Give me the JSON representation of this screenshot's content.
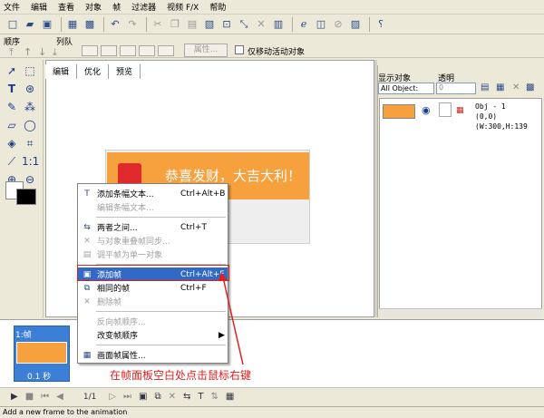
{
  "menu": [
    "文件",
    "编辑",
    "查看",
    "对象",
    "帧",
    "过滤器",
    "视频 F/X",
    "帮助"
  ],
  "order_bar": {
    "order_label": "顺序",
    "arrange_label": "列队",
    "properties_button": "属性...",
    "move_active_label": "仅移动活动对象"
  },
  "tabs": [
    "编辑",
    "优化",
    "预览"
  ],
  "banner_text": "恭喜发财，大吉大利！",
  "right_panel": {
    "display_label": "显示对象",
    "transparency_label": "透明",
    "object_select": "All Object:",
    "transparency_value": "0",
    "object_name": "Obj - 1",
    "object_info": "(0,0)(W:300,H:139"
  },
  "frame": {
    "label": "1:帧",
    "time": "0.1 秒"
  },
  "frame_counter": "1/1",
  "context_menu": [
    {
      "label": "添加条幅文本...",
      "shortcut": "Ctrl+Alt+B",
      "disabled": false,
      "highlight": false
    },
    {
      "label": "编辑条幅文本...",
      "shortcut": "",
      "disabled": true,
      "highlight": false
    },
    {
      "label": "两者之间...",
      "shortcut": "Ctrl+T",
      "disabled": false,
      "highlight": false
    },
    {
      "label": "与对象重叠帧同步...",
      "shortcut": "",
      "disabled": true,
      "highlight": false
    },
    {
      "label": "调平帧为单一对象",
      "shortcut": "",
      "disabled": true,
      "highlight": false
    },
    {
      "label": "添加帧",
      "shortcut": "Ctrl+Alt+F",
      "disabled": false,
      "highlight": true
    },
    {
      "label": "相同的帧",
      "shortcut": "Ctrl+F",
      "disabled": false,
      "highlight": false
    },
    {
      "label": "删除帧",
      "shortcut": "",
      "disabled": true,
      "highlight": false
    },
    {
      "label": "反向帧顺序...",
      "shortcut": "",
      "disabled": true,
      "highlight": false
    },
    {
      "label": "改变帧顺序",
      "shortcut": "▶",
      "disabled": false,
      "highlight": false
    },
    {
      "label": "画面帧属性...",
      "shortcut": "",
      "disabled": false,
      "highlight": false
    }
  ],
  "annotation": "在帧面板空白处点击鼠标右键",
  "status": "Add a new frame to the animation",
  "colors": {
    "highlight": "#316ac5",
    "annotation": "#e0201e",
    "banner": "#f7a03e"
  }
}
